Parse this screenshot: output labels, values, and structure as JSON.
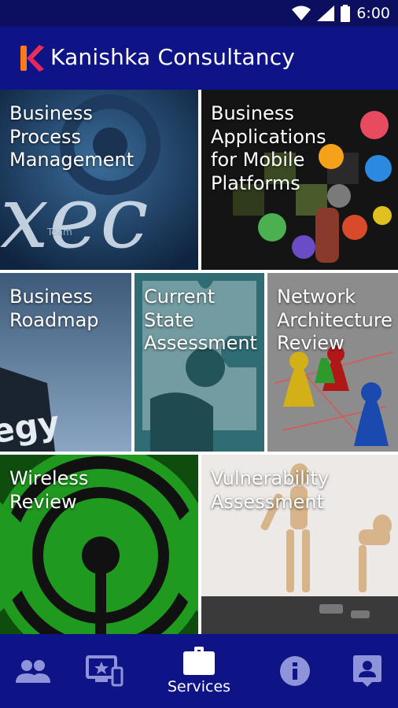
{
  "status_bar": {
    "time": "6:00"
  },
  "app_bar": {
    "title": "Kanishka Consultancy",
    "logo_letter": "K"
  },
  "tiles": [
    {
      "label": "Business\nProcess\nManagement"
    },
    {
      "label": "Business\nApplications\nfor Mobile\nPlatforms"
    },
    {
      "label": "Business\nRoadmap"
    },
    {
      "label": "Current\nState\nAssessment"
    },
    {
      "label": "Network\nArchitecture\nReview"
    },
    {
      "label": "Wireless\nReview"
    },
    {
      "label": "Vulnerability\nAssessment"
    }
  ],
  "bottom_nav": {
    "items": [
      {
        "icon": "people-icon",
        "label": ""
      },
      {
        "icon": "desktop-star-icon",
        "label": ""
      },
      {
        "icon": "briefcase-icon",
        "label": "Services",
        "selected": true
      },
      {
        "icon": "info-icon",
        "label": ""
      },
      {
        "icon": "contact-card-icon",
        "label": ""
      }
    ]
  },
  "colors": {
    "primary": "#0e1486",
    "status_bar": "#0b0f5e",
    "text": "#ffffff"
  }
}
